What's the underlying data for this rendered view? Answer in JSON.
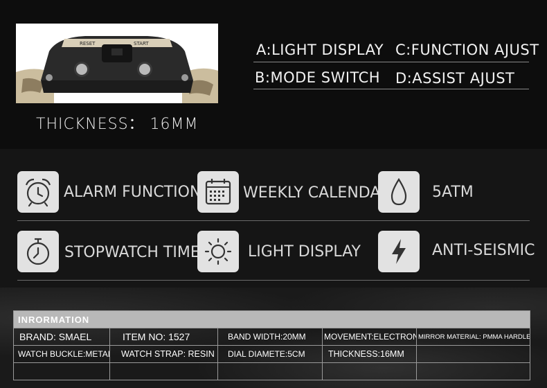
{
  "top": {
    "thickness": "THICKNESS： 16MM",
    "functions": {
      "a": "A:LIGHT DISPLAY",
      "b": "B:MODE SWITCH",
      "c": "C:FUNCTION AJUST",
      "d": "D:ASSIST AJUST"
    },
    "photo_labels": {
      "left": "RESET",
      "right": "START"
    }
  },
  "features": {
    "alarm": "ALARM FUNCTION",
    "calendar": "WEEKLY CALENDAR",
    "water": "5ATM",
    "stopwatch": "STOPWATCH TIME",
    "light": "LIGHT DISPLAY",
    "seismic": "ANTI-SEISMIC"
  },
  "info": {
    "header": "INRORMATION",
    "row1": [
      "BRAND:  SMAEL",
      "ITEM NO:  1527",
      "BAND WIDTH:20MM",
      "MOVEMENT:ELECTRONIC",
      "MIRROR MATERIAL: PMMA HARDLEX"
    ],
    "row2": [
      "WATCH BUCKLE:METAL",
      "WATCH STRAP: RESIN",
      "DIAL DIAMETE:5CM",
      "THICKNESS:16MM",
      ""
    ],
    "row3": [
      "",
      "",
      "",
      "",
      ""
    ]
  }
}
